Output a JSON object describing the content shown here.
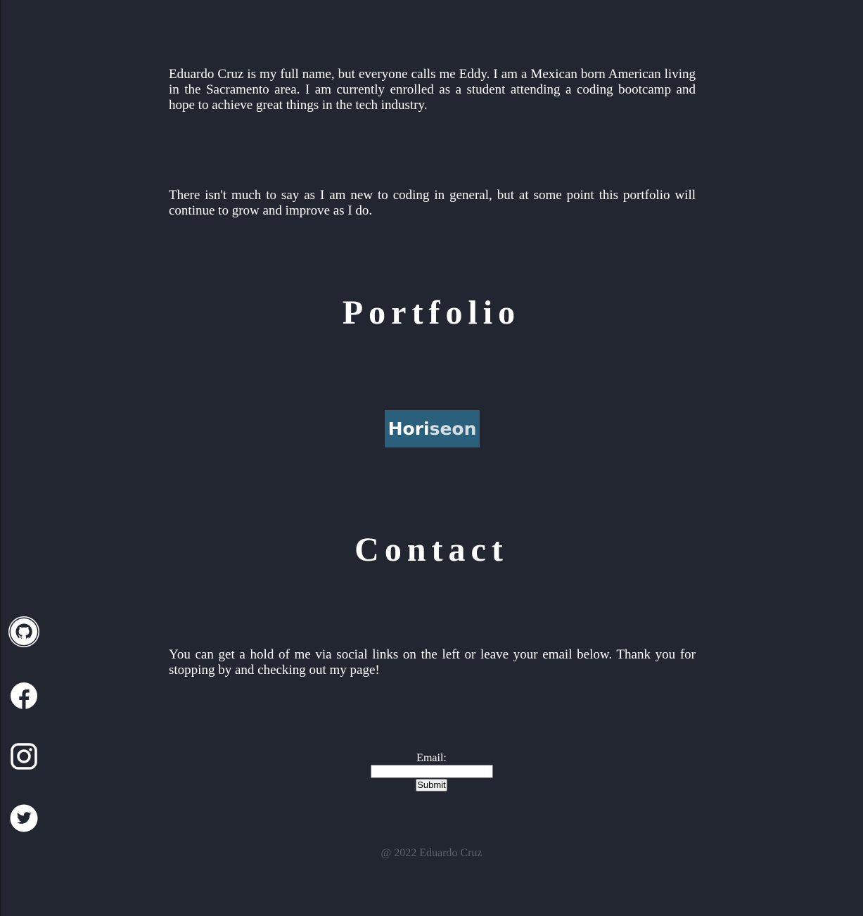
{
  "about": {
    "paragraph_1": "Eduardo Cruz is my full name, but everyone calls me Eddy. I am a Mexican born American living in the Sacramento area. I am currently enrolled as a student attending a coding bootcamp and hope to achieve great things in the tech industry.",
    "paragraph_2": "There isn't much to say as I am new to coding in general, but at some point this portfolio will continue to grow and improve as I do."
  },
  "portfolio": {
    "heading": "Portfolio",
    "projects": [
      {
        "name_main": "Hori",
        "name_accent": "seon",
        "tile_color": "#2a607c"
      }
    ]
  },
  "contact": {
    "heading": "Contact",
    "text": "You can get a hold of me via social links on the left or leave your email below. Thank you for stopping by and checking out my page!",
    "form": {
      "email_label": "Email:",
      "email_value": "",
      "submit_label": "Submit"
    }
  },
  "social_links": [
    {
      "icon": "github-icon"
    },
    {
      "icon": "facebook-icon"
    },
    {
      "icon": "instagram-icon"
    },
    {
      "icon": "twitter-icon"
    }
  ],
  "footer": {
    "text": "@ 2022 Eduardo Cruz"
  },
  "colors": {
    "background": "#222631",
    "text": "#ffffff",
    "footer_text": "#5d6270",
    "project_tile": "#2a607c"
  }
}
